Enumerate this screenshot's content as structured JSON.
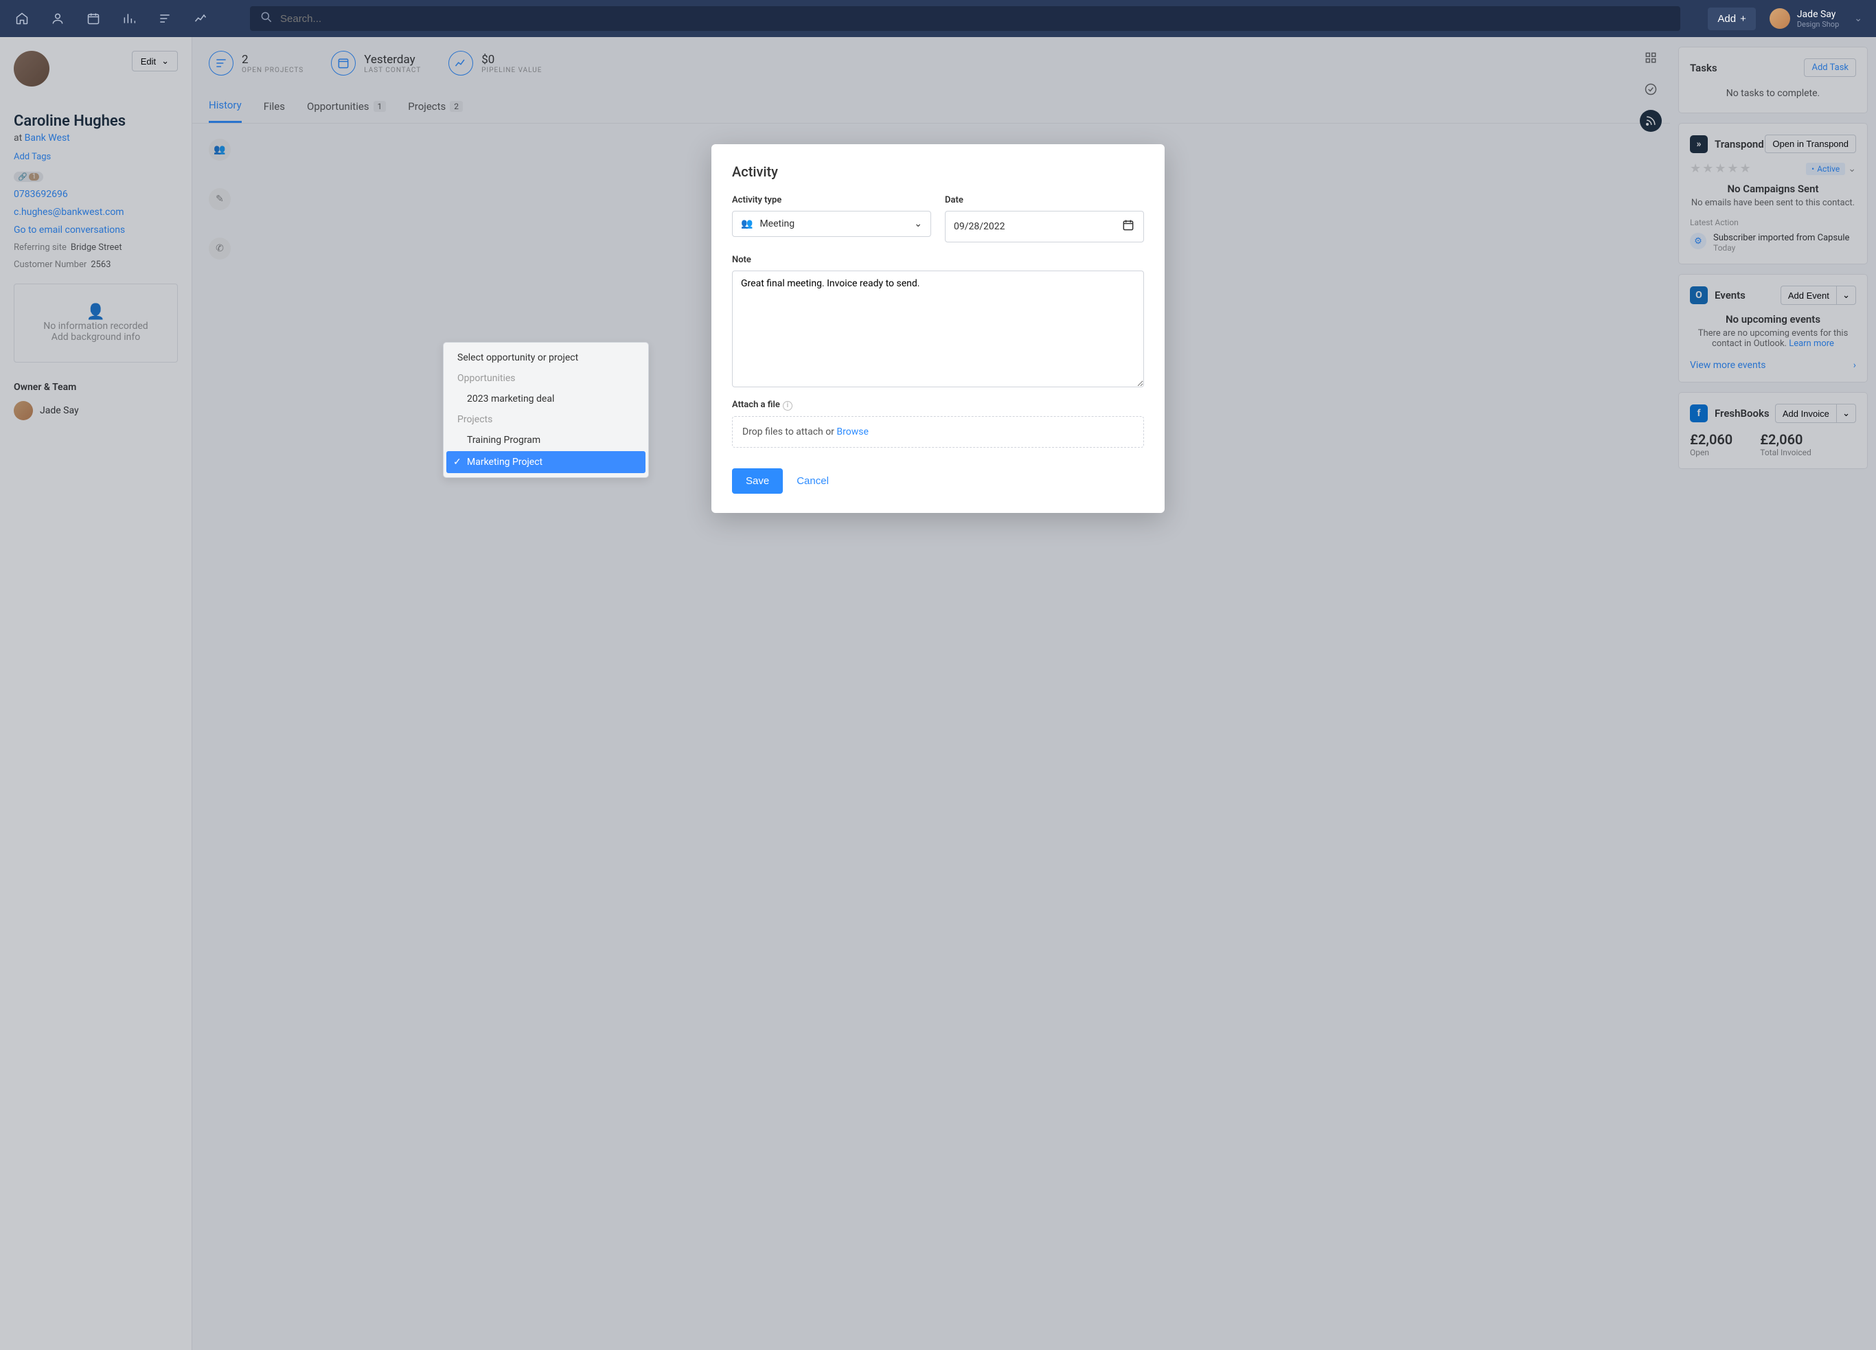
{
  "topbar": {
    "search_placeholder": "Search...",
    "add_label": "Add",
    "user_name": "Jade Say",
    "user_org": "Design Shop"
  },
  "contact": {
    "name": "Caroline Hughes",
    "company_prefix": "at ",
    "company": "Bank West",
    "add_tags": "Add Tags",
    "link_badge_count": "1",
    "phone": "0783692696",
    "email": "c.hughes@bankwest.com",
    "email_conv": "Go to email conversations",
    "ref_site_label": "Referring site",
    "ref_site_value": "Bridge Street",
    "cust_num_label": "Customer Number",
    "cust_num_value": "2563",
    "no_info": "No information recorded",
    "add_bg": "Add background info",
    "edit_label": "Edit"
  },
  "owner": {
    "section": "Owner & Team",
    "name": "Jade Say"
  },
  "stats": {
    "open_val": "2",
    "open_label": "OPEN PROJECTS",
    "last_val": "Yesterday",
    "last_label": "LAST CONTACT",
    "pipe_val": "$0",
    "pipe_label": "PIPELINE VALUE"
  },
  "tabs": {
    "history": "History",
    "files": "Files",
    "opps": "Opportunities",
    "opps_badge": "1",
    "projects": "Projects",
    "projects_badge": "2"
  },
  "modal": {
    "title": "Activity",
    "type_label": "Activity type",
    "type_value": "Meeting",
    "date_label": "Date",
    "date_value": "09/28/2022",
    "note_label": "Note",
    "note_value": "Great final meeting. Invoice ready to send.",
    "attach_label": "Attach a file",
    "attach_text": "Drop files to attach or ",
    "attach_browse": "Browse",
    "save": "Save",
    "cancel": "Cancel"
  },
  "dropdown": {
    "select_prompt": "Select opportunity or project",
    "opps_header": "Opportunities",
    "opp1": "2023 marketing deal",
    "proj_header": "Projects",
    "proj1": "Training Program",
    "proj2": "Marketing Project"
  },
  "tasks": {
    "title": "Tasks",
    "add": "Add Task",
    "empty": "No tasks to complete."
  },
  "transpond": {
    "title": "Transpond",
    "open": "Open in Transpond",
    "active": "Active",
    "no_campaigns": "No Campaigns Sent",
    "no_emails": "No emails have been sent to this contact.",
    "latest_label": "Latest Action",
    "latest_title": "Subscriber imported from Capsule",
    "latest_time": "Today"
  },
  "events": {
    "title": "Events",
    "add": "Add Event",
    "none_title": "No upcoming events",
    "none_text": "There are no upcoming events for this contact in Outlook. ",
    "learn": "Learn more",
    "view_more": "View more events"
  },
  "freshbooks": {
    "title": "FreshBooks",
    "add": "Add Invoice",
    "open_amt": "£2,060",
    "open_lbl": "Open",
    "total_amt": "£2,060",
    "total_lbl": "Total Invoiced"
  }
}
